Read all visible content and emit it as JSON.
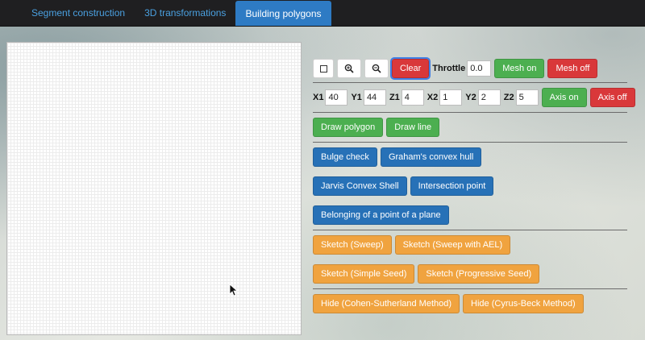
{
  "nav": {
    "tabs": [
      "Segment construction",
      "3D transformations",
      "Building polygons"
    ],
    "active": 2
  },
  "toolbar": {
    "clear": "Clear",
    "throttle_label": "Throttle",
    "throttle_value": "0.0",
    "mesh_on": "Mesh on",
    "mesh_off": "Mesh off"
  },
  "coords": {
    "x1_label": "X1",
    "x1": "40",
    "y1_label": "Y1",
    "y1": "44",
    "z1_label": "Z1",
    "z1": "4",
    "x2_label": "X2",
    "x2": "1",
    "y2_label": "Y2",
    "y2": "2",
    "z2_label": "Z2",
    "z2": "5",
    "axis_on": "Axis on",
    "axis_off": "Axis off"
  },
  "draw": {
    "polygon": "Draw polygon",
    "line": "Draw line"
  },
  "analysis": {
    "bulge": "Bulge check",
    "graham": "Graham's convex hull",
    "jarvis": "Jarvis Convex Shell",
    "intersection": "Intersection point",
    "belonging": "Belonging of a point of a plane"
  },
  "sketch": {
    "sweep": "Sketch (Sweep)",
    "sweep_ael": "Sketch (Sweep with AEL)",
    "simple_seed": "Sketch (Simple Seed)",
    "progressive_seed": "Sketch (Progressive Seed)"
  },
  "hide": {
    "cohen": "Hide (Cohen-Sutherland Method)",
    "cyrus": "Hide (Cyrus-Beck Method)"
  },
  "colors": {
    "blue": "#2771b7",
    "green": "#4caf50",
    "red": "#d9383a",
    "orange": "#f0a33f"
  }
}
